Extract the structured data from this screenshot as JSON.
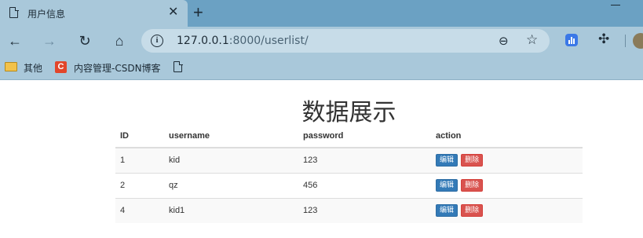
{
  "browser": {
    "tab": {
      "title": "用户信息",
      "close": "✕"
    },
    "new_tab": "+",
    "address": {
      "host": "127.0.0.1",
      "path": ":8000/userlist/"
    },
    "bookmarks": [
      {
        "label": "其他",
        "icon": "folder-icon"
      },
      {
        "label": "内容管理-CSDN博客",
        "icon": "csdn-icon"
      }
    ],
    "csdn_letter": "C"
  },
  "page": {
    "title": "数据展示",
    "columns": [
      "ID",
      "username",
      "password",
      "action"
    ],
    "rows": [
      {
        "id": "1",
        "username": "kid",
        "password": "123"
      },
      {
        "id": "2",
        "username": "qz",
        "password": "456"
      },
      {
        "id": "4",
        "username": "kid1",
        "password": "123"
      }
    ],
    "edit_label": "编辑",
    "delete_label": "删除"
  },
  "colors": {
    "tab_strip": "#6ba1c3",
    "toolbar": "#a9c8da",
    "edit_button": "#337ab7",
    "delete_button": "#d9534f"
  }
}
